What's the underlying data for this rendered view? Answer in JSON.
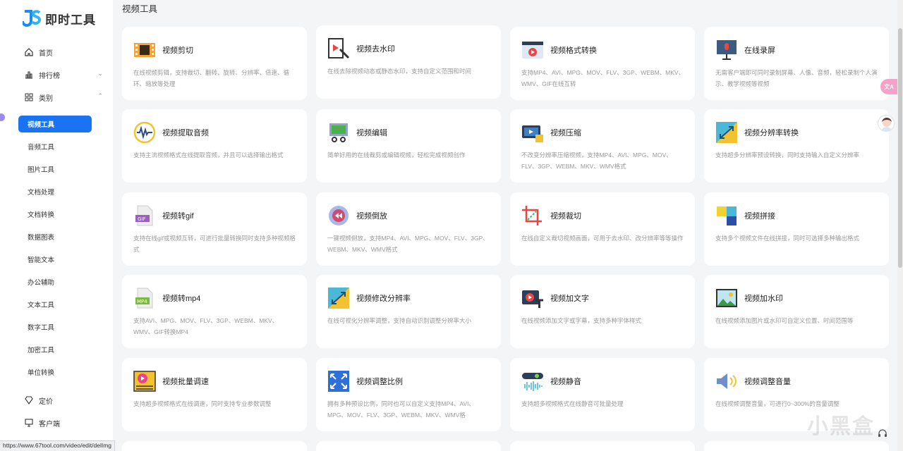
{
  "app": {
    "name": "即时工具"
  },
  "nav": {
    "home": "首页",
    "ranking": "排行榜",
    "category": "类别",
    "pricing": "定价",
    "client": "客户端"
  },
  "categories": [
    "视频工具",
    "音频工具",
    "图片工具",
    "文档处理",
    "文档转换",
    "数据图表",
    "智能文本",
    "办公辅助",
    "文本工具",
    "数字工具",
    "加密工具",
    "单位转换"
  ],
  "main": {
    "title": "视频工具"
  },
  "cards": [
    {
      "title": "视频剪切",
      "desc": "在线视频剪辑，支持裁切、翻转、旋转、分辨率、倍速、循环、缩放等处理",
      "icon": "film-strip-icon"
    },
    {
      "title": "视频去水印",
      "desc": "在线去除视频动态或静态水印，支持自定义范围和时间",
      "icon": "magic-wand-icon"
    },
    {
      "title": "视频格式转换",
      "desc": "支持MP4、AVI、MPG、MOV、FLV、3GP、WEBM、MKV、WMV、GIF在线互转",
      "icon": "video-window-icon"
    },
    {
      "title": "在线录屏",
      "desc": "无需客户端即可同时录制屏幕、人像、音频，轻松录制个人演示、教学视频等视频",
      "icon": "microphone-icon"
    },
    {
      "title": "视频提取音频",
      "desc": "支持主流视频格式在线提取音频，并且可以选择输出格式",
      "icon": "waveform-icon"
    },
    {
      "title": "视频编辑",
      "desc": "简单好用的在线裁剪或编辑视频，轻松完成视频创作",
      "icon": "film-scissors-icon"
    },
    {
      "title": "视频压缩",
      "desc": "不改变分辨率压缩视频，支持MP4、AVI、MPG、MOV、FLV、3GP、WEBM、MKV、WMV格式",
      "icon": "video-compress-icon"
    },
    {
      "title": "视频分辨率转换",
      "desc": "支持超多分辨率预设转换，同时支持输入自定义分辨率",
      "icon": "resize-arrow-icon"
    },
    {
      "title": "视频转gif",
      "desc": "支持在线gif或视频互转，可进行批量转换同时支持多种视频格式",
      "icon": "gif-file-icon"
    },
    {
      "title": "视频倒放",
      "desc": "一键视频倒放，支持MP4、AVI、MPG、MOV、FLV、3GP、WEBM、MKV、WMV格式",
      "icon": "rewind-icon"
    },
    {
      "title": "视频裁切",
      "desc": "在线自定义裁切视频画面，可用于去水印、改分辨率等等操作",
      "icon": "crop-icon"
    },
    {
      "title": "视频拼接",
      "desc": "支持多个视频文件在线拼接，同时可选择多种输出格式",
      "icon": "blocks-icon"
    },
    {
      "title": "视频转mp4",
      "desc": "支持AVI、MPG、MOV、FLV、3GP、WEBM、MKV、WMV、GIF转换MP4",
      "icon": "mp4-file-icon"
    },
    {
      "title": "视频修改分辨率",
      "desc": "在线可视化分辨率调整，支持自动识别调整分辨率大小",
      "icon": "resize-arrow-icon"
    },
    {
      "title": "视频加文字",
      "desc": "在线视频添加文字或字幕，支持多种字体样式",
      "icon": "video-text-icon"
    },
    {
      "title": "视频加水印",
      "desc": "在线视频添加图片或水印可自定义位置、时间范围等",
      "icon": "image-icon"
    },
    {
      "title": "视频批量调速",
      "desc": "支持超多视频格式在线调速，同时支持专业参数调整",
      "icon": "speed-icon"
    },
    {
      "title": "视频调整比例",
      "desc": "拥有多种预设比例，同时也可以自定义支持MP4、AVI、MPG、MOV、FLV、3GP、WEBM、MKV、WMV格",
      "icon": "aspect-ratio-icon"
    },
    {
      "title": "视频静音",
      "desc": "支持超多视频格式在线静音可批量处理",
      "icon": "mute-icon"
    },
    {
      "title": "视频调整音量",
      "desc": "在线视频调整音量，可进行0~300%的音量调整",
      "icon": "speaker-icon"
    }
  ],
  "status_bar": {
    "url": "https://www.67tool.com/video/edit/delImg"
  },
  "watermark": "小黑盒",
  "float_badge": "文A",
  "colors": {
    "accent": "#1a73f0",
    "page_bg": "#f4f5f7"
  }
}
